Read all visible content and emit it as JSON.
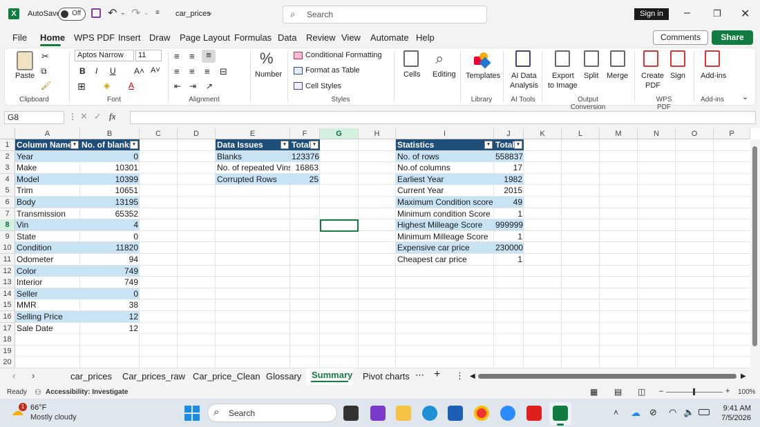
{
  "app": {
    "autosave_label": "AutoSave",
    "autosave_state": "Off",
    "file_name": "car_prices",
    "search_placeholder": "Search",
    "sign_in": "Sign in"
  },
  "menu": [
    "File",
    "Home",
    "WPS PDF",
    "Insert",
    "Draw",
    "Page Layout",
    "Formulas",
    "Data",
    "Review",
    "View",
    "Automate",
    "Help"
  ],
  "menu_right": {
    "comments": "Comments",
    "share": "Share"
  },
  "ribbon": {
    "paste": "Paste",
    "clipboard": "Clipboard",
    "font_name": "Aptos Narrow",
    "font_size": "11",
    "font": "Font",
    "alignment": "Alignment",
    "number": "Number",
    "cond_format": "Conditional Formatting",
    "format_table": "Format as Table",
    "cell_styles": "Cell Styles",
    "styles": "Styles",
    "cells": "Cells",
    "editing": "Editing",
    "templates": "Templates",
    "library": "Library",
    "ai_data_1": "AI Data",
    "ai_data_2": "Analysis",
    "ai_tools": "AI Tools",
    "export_1": "Export",
    "export_2": "to Image",
    "split": "Split",
    "merge": "Merge",
    "output_conv": "Output Conversion",
    "create_1": "Create",
    "create_2": "PDF",
    "sign": "Sign",
    "wps_pdf": "WPS PDF",
    "addins": "Add-ins",
    "addins_grp": "Add-ins"
  },
  "formula_bar": {
    "cell_ref": "G8",
    "fx": "fx",
    "content": ""
  },
  "columns": [
    "A",
    "B",
    "C",
    "D",
    "E",
    "F",
    "G",
    "H",
    "I",
    "J",
    "K",
    "L",
    "M",
    "N",
    "O",
    "P"
  ],
  "rows": [
    "1",
    "2",
    "3",
    "4",
    "5",
    "6",
    "7",
    "8",
    "9",
    "10",
    "11",
    "12",
    "13",
    "14",
    "15",
    "16",
    "17",
    "18",
    "19",
    "20"
  ],
  "table1": {
    "headers": [
      "Column Name",
      "No. of blanks"
    ],
    "rows": [
      [
        "Year",
        "0"
      ],
      [
        "Make",
        "10301"
      ],
      [
        "Model",
        "10399"
      ],
      [
        "Trim",
        "10651"
      ],
      [
        "Body",
        "13195"
      ],
      [
        "Transmission",
        "65352"
      ],
      [
        "Vin",
        "4"
      ],
      [
        "State",
        "0"
      ],
      [
        "Condition",
        "11820"
      ],
      [
        "Odometer",
        "94"
      ],
      [
        "Color",
        "749"
      ],
      [
        "Interior",
        "749"
      ],
      [
        "Seller",
        "0"
      ],
      [
        "MMR",
        "38"
      ],
      [
        "Selling Price",
        "12"
      ],
      [
        "Sale Date",
        "12"
      ]
    ]
  },
  "table2": {
    "headers": [
      "Data Issues",
      "Total"
    ],
    "rows": [
      [
        "Blanks",
        "123376"
      ],
      [
        "No. of repeated Vins",
        "16863"
      ],
      [
        "Corrupted Rows",
        "25"
      ]
    ]
  },
  "table3": {
    "headers": [
      "Statistics",
      "Total"
    ],
    "rows": [
      [
        "No. of rows",
        "558837"
      ],
      [
        "No.of columns",
        "17"
      ],
      [
        "Earliest Year",
        "1982"
      ],
      [
        "Current Year",
        "2015"
      ],
      [
        "Maximum Condition  score",
        "49"
      ],
      [
        "Minimum condition Score",
        "1"
      ],
      [
        "Highest Milleage Score",
        "999999"
      ],
      [
        "Minimum Milleage Score",
        "1"
      ],
      [
        "Expensive car price",
        "230000"
      ],
      [
        "Cheapest car price",
        "1"
      ]
    ]
  },
  "sheets": [
    "car_prices",
    "Car_prices_raw",
    "Car_price_Clean",
    "Glossary",
    "Summary",
    "Pivot charts"
  ],
  "active_sheet": "Summary",
  "status": {
    "ready": "Ready",
    "accessibility": "Accessibility: Investigate",
    "zoom": "100%"
  },
  "taskbar": {
    "weather_temp": "66°F",
    "weather_desc": "Mostly cloudy",
    "weather_badge": "1",
    "search": "Search",
    "time": "9:41 AM",
    "date": "7/5/2026"
  },
  "colors": {
    "excel_green": "#107c41",
    "table_header": "#1f4e79",
    "band": "#c8e3f4"
  }
}
